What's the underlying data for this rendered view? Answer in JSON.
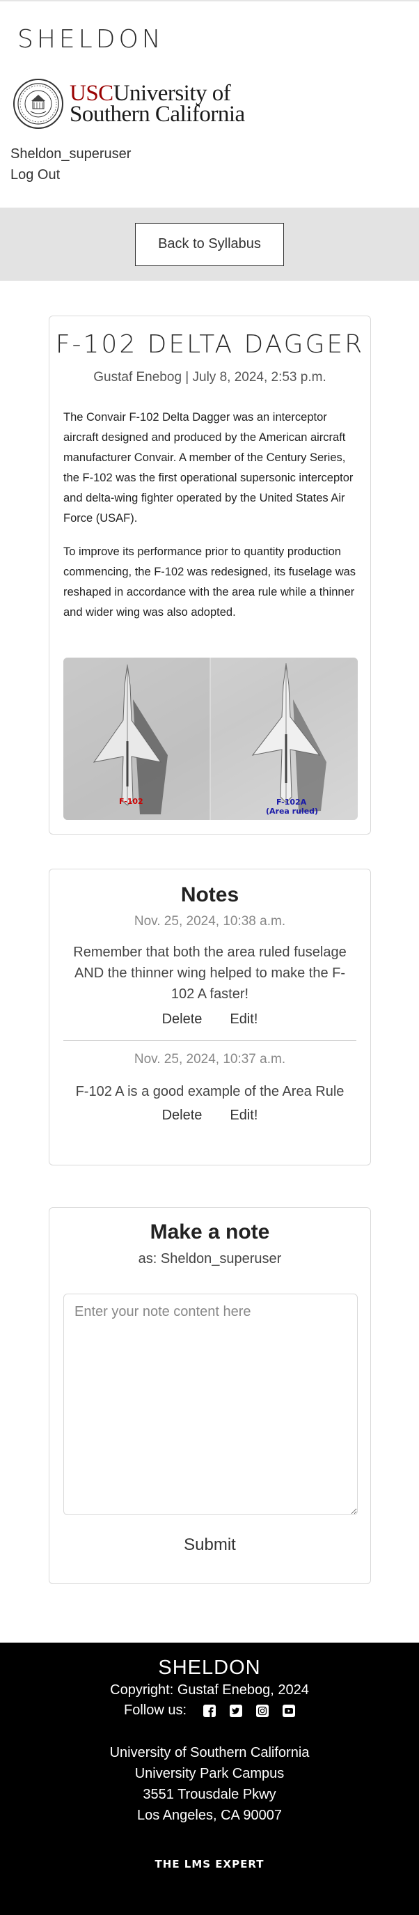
{
  "header": {
    "brand": "SHELDON",
    "usc_prefix": "USC",
    "usc_line1_rest": "University of",
    "usc_line2": "Southern California",
    "username": "Sheldon_superuser",
    "logout": "Log Out"
  },
  "nav": {
    "back_label": "Back to Syllabus"
  },
  "article": {
    "title": "F-102 DELTA DAGGER",
    "meta": "Gustaf Enebog | July 8, 2024, 2:53 p.m.",
    "paragraphs": [
      "The Convair F-102 Delta Dagger was an interceptor aircraft designed and produced by the American aircraft manufacturer Convair. A member of the Century Series, the F-102 was the first operational supersonic interceptor and delta-wing fighter operated by the United States Air Force (USAF).",
      "To improve its performance prior to quantity production commencing, the F-102 was redesigned, its fuselage was reshaped in accordance with the area rule while a thinner and wider wing was also adopted."
    ],
    "image_labels": {
      "left": "F-102",
      "right_line1": "F-102A",
      "right_line2": "(Area ruled)"
    }
  },
  "notes": {
    "title": "Notes",
    "items": [
      {
        "date": "Nov. 25, 2024, 10:38 a.m.",
        "text": "Remember that both the area ruled fuselage AND the thinner wing helped to make the F-102 A faster!",
        "delete": "Delete",
        "edit": "Edit!"
      },
      {
        "date": "Nov. 25, 2024, 10:37 a.m.",
        "text": "F-102 A is a good example of the Area Rule",
        "delete": "Delete",
        "edit": "Edit!"
      }
    ]
  },
  "make_note": {
    "title": "Make a note",
    "as_user": "as: Sheldon_superuser",
    "placeholder": "Enter your note content here",
    "submit": "Submit"
  },
  "footer": {
    "brand": "SHELDON",
    "copyright": "Copyright: Gustaf Enebog, 2024",
    "follow": "Follow us:",
    "social_icons": [
      "facebook-icon",
      "twitter-icon",
      "instagram-icon",
      "youtube-icon"
    ],
    "address": [
      "University of Southern California",
      "University Park Campus",
      "3551 Trousdale Pkwy",
      "Los Angeles, CA 90007"
    ],
    "partner": "THE LMS EXPERT"
  },
  "colors": {
    "usc_cardinal": "#990000",
    "band_gray": "#e3e3e3",
    "footer_bg": "#000000",
    "label_red": "#cc0000",
    "label_blue": "#1a1aa8"
  }
}
